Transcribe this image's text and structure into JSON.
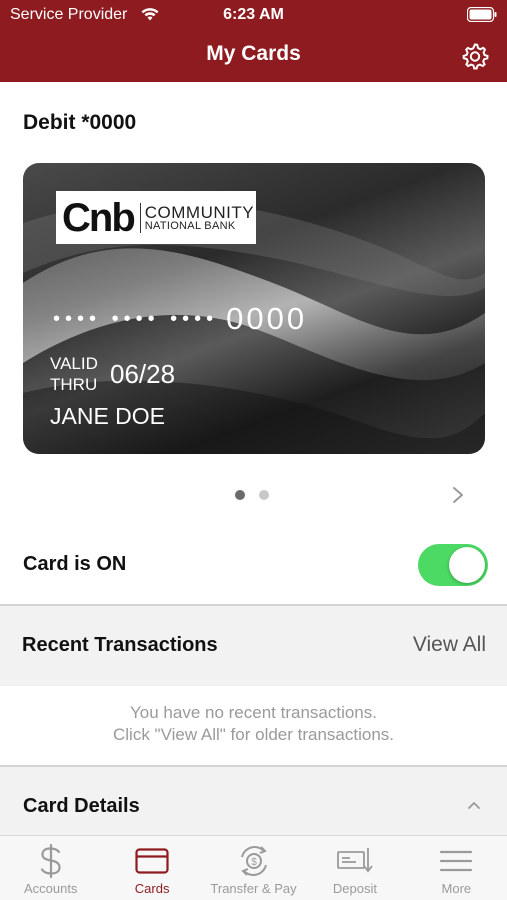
{
  "status_bar": {
    "carrier": "Service Provider",
    "time": "6:23 AM"
  },
  "header": {
    "title": "My Cards",
    "settings_icon": "gear-icon"
  },
  "card": {
    "heading": "Debit *0000",
    "logo": {
      "mark": "Cnb",
      "line1": "COMMUNITY",
      "line2": "NATIONAL BANK"
    },
    "masked_groups": "•••• •••• ••••",
    "last4": "0000",
    "valid_line1": "VALID",
    "valid_line2": "THRU",
    "expiry": "06/28",
    "holder": "JANE DOE",
    "pager": {
      "count": 2,
      "active_index": 0
    }
  },
  "card_toggle": {
    "label": "Card is ON",
    "on": true,
    "on_color": "#4cd964"
  },
  "recent_transactions": {
    "title": "Recent Transactions",
    "view_all": "View All",
    "empty_line1": "You have no recent transactions.",
    "empty_line2": "Click \"View All\" for older transactions."
  },
  "card_details": {
    "title": "Card Details"
  },
  "tab_bar": {
    "tabs": [
      {
        "label": "Accounts",
        "icon": "dollar-icon",
        "active": false
      },
      {
        "label": "Cards",
        "icon": "card-icon",
        "active": true
      },
      {
        "label": "Transfer & Pay",
        "icon": "transfer-icon",
        "active": false
      },
      {
        "label": "Deposit",
        "icon": "deposit-check-icon",
        "active": false
      },
      {
        "label": "More",
        "icon": "menu-icon",
        "active": false
      }
    ]
  },
  "colors": {
    "brand": "#8e1b1f",
    "toggle_on": "#4cd964",
    "muted_text": "#9a9a9a"
  }
}
